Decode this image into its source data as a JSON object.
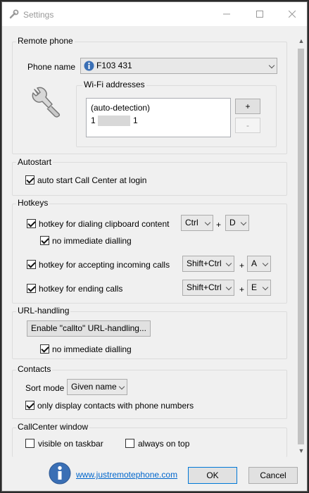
{
  "window": {
    "title": "Settings"
  },
  "remote_phone": {
    "legend": "Remote phone",
    "phone_name_label": "Phone name",
    "phone_name_value": "F103 431",
    "wifi_legend": "Wi-Fi addresses",
    "wifi_items": [
      "(auto-detection)",
      "1",
      "1"
    ],
    "add_label": "+",
    "remove_label": "-"
  },
  "autostart": {
    "legend": "Autostart",
    "auto_start_label": "auto start Call Center at login",
    "auto_start_checked": true
  },
  "hotkeys": {
    "legend": "Hotkeys",
    "dial_clipboard_label": "hotkey for dialing clipboard content",
    "dial_clipboard_mod": "Ctrl",
    "dial_clipboard_key": "D",
    "no_immediate_label": "no immediate dialling",
    "accept_label": "hotkey for accepting incoming calls",
    "accept_mod": "Shift+Ctrl",
    "accept_key": "A",
    "end_label": "hotkey for ending calls",
    "end_mod": "Shift+Ctrl",
    "end_key": "E",
    "plus": "+"
  },
  "url_handling": {
    "legend": "URL-handling",
    "enable_button": "Enable \"callto\" URL-handling...",
    "no_immediate_label": "no immediate dialling"
  },
  "contacts": {
    "legend": "Contacts",
    "sort_mode_label": "Sort mode",
    "sort_mode_value": "Given name",
    "only_phone_label": "only display contacts with phone numbers"
  },
  "callcenter_window": {
    "legend": "CallCenter window",
    "visible_taskbar_label": "visible on taskbar",
    "always_on_top_label": "always on top"
  },
  "footer": {
    "link": "www.justremotephone.com",
    "ok_label": "OK",
    "cancel_label": "Cancel"
  },
  "colors": {
    "accent": "#0078d7",
    "link": "#0066cc",
    "info_icon": "#3a6fb5"
  }
}
